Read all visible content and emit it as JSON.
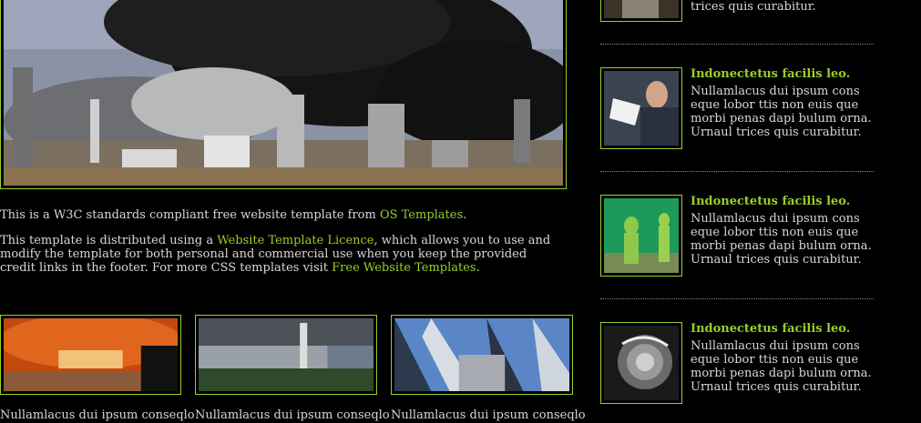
{
  "intro": {
    "p1_text": "This is a W3C standards compliant free website template from ",
    "p1_link": "OS Templates",
    "p1_end": ".",
    "p2_text_a": "This template is distributed using a ",
    "p2_link_a": "Website Template Licence",
    "p2_text_b": ", which allows you to use and modify the template for both personal and commercial use when you keep the provided credit links in the footer. For more CSS templates visit ",
    "p2_link_b": "Free Website Templates",
    "p2_end": "."
  },
  "gallery": [
    {
      "caption": "Nullamlacus dui ipsum conseqlo"
    },
    {
      "caption": "Nullamlacus dui ipsum conseqlo"
    },
    {
      "caption": "Nullamlacus dui ipsum conseqlo"
    }
  ],
  "sidebar": {
    "top_fragment": "trices quis curabitur.",
    "items": [
      {
        "title": "Indonectetus facilis leo.",
        "body": "Nullamlacus dui ipsum cons eque lobor ttis non euis que morbi penas dapi bulum orna. Urnaul trices quis curabitur."
      },
      {
        "title": "Indonectetus facilis leo.",
        "body": "Nullamlacus dui ipsum cons eque lobor ttis non euis que morbi penas dapi bulum orna. Urnaul trices quis curabitur."
      },
      {
        "title": "Indonectetus facilis leo.",
        "body": "Nullamlacus dui ipsum cons eque lobor ttis non euis que morbi penas dapi bulum orna. Urnaul trices quis curabitur."
      }
    ]
  },
  "colors": {
    "accent": "#9ace2a",
    "background": "#000000",
    "text": "#d8d8d8"
  }
}
